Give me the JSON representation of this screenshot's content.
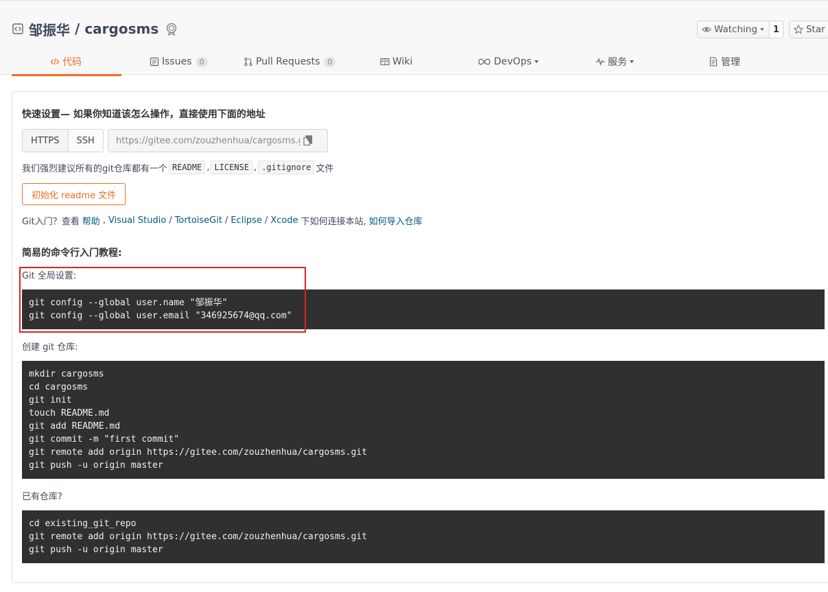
{
  "repo": {
    "owner": "邹振华",
    "separator": "/",
    "name": "cargosms"
  },
  "actions": {
    "watch_label": "Watching",
    "watch_count": "1",
    "star_label": "Star"
  },
  "tabs": [
    {
      "label": "代码"
    },
    {
      "label": "Issues",
      "count": "0"
    },
    {
      "label": "Pull Requests",
      "count": "0"
    },
    {
      "label": "Wiki"
    },
    {
      "label": "DevOps"
    },
    {
      "label": "服务"
    },
    {
      "label": "管理"
    }
  ],
  "quick": {
    "title": "快速设置— 如果你知道该怎么操作，直接使用下面的地址",
    "https": "HTTPS",
    "ssh": "SSH",
    "url": "https://gitee.com/zouzhenhua/cargosms.git"
  },
  "recommend": {
    "prefix": "我们强烈建议所有的git仓库都有一个",
    "readme": "README",
    "comma1": ",",
    "license": "LICENSE",
    "comma2": ",",
    "gitignore": ".gitignore",
    "suffix": "文件"
  },
  "init_button": "初始化 readme 文件",
  "gitintro": {
    "prefix": "Git入门？查看",
    "help": "帮助",
    "comma": ",",
    "vs": "Visual Studio",
    "slash1": "/",
    "tortoise": "TortoiseGit",
    "slash2": "/",
    "eclipse": "Eclipse",
    "slash3": "/",
    "xcode": "Xcode",
    "middle": "下如何连接本站,",
    "import": "如何导入仓库"
  },
  "tutorial": {
    "title": "简易的命令行入门教程:",
    "global_label": "Git 全局设置:",
    "global_lines": [
      "git config --global user.name \"邹振华\"",
      "git config --global user.email \"346925674@qq.com\""
    ],
    "create_label": "创建 git 仓库:",
    "create_lines": [
      "mkdir cargosms",
      "cd cargosms",
      "git init",
      "touch README.md",
      "git add README.md",
      "git commit -m \"first commit\"",
      "git remote add origin https://gitee.com/zouzhenhua/cargosms.git",
      "git push -u origin master"
    ],
    "existing_label": "已有仓库?",
    "existing_lines": [
      "cd existing_git_repo",
      "git remote add origin https://gitee.com/zouzhenhua/cargosms.git",
      "git push -u origin master"
    ]
  },
  "colors": {
    "accent": "#f36c20",
    "link": "#005980",
    "code_bg": "#303030",
    "highlight": "#e02020"
  }
}
